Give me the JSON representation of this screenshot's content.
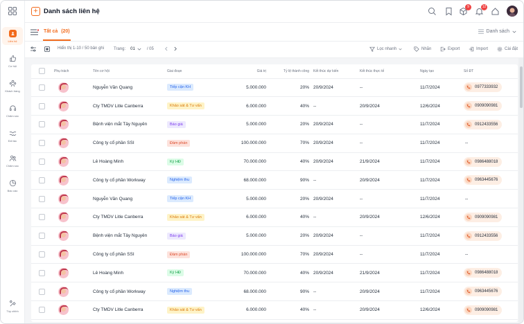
{
  "sidebar": {
    "items": [
      {
        "label": "Liên hệ",
        "icon": "contact-icon"
      },
      {
        "label": "Cơ hội",
        "icon": "thumbs-up-icon"
      },
      {
        "label": "Khách hàng",
        "icon": "customers-icon"
      },
      {
        "label": "Chăm sóc",
        "icon": "headset-icon"
      },
      {
        "label": "Đối tác",
        "icon": "handshake-icon"
      },
      {
        "label": "Chăm sóc",
        "icon": "group-icon"
      },
      {
        "label": "Báo cáo",
        "icon": "chart-icon"
      },
      {
        "label": "Tùy chỉnh",
        "icon": "settings-icon"
      }
    ]
  },
  "header": {
    "title": "Danh sách liên hệ",
    "badges": {
      "messages": "9",
      "notifications": "12"
    }
  },
  "tabs": {
    "all_label": "Tất cả",
    "all_count": "(20)",
    "view_label": "Danh sách"
  },
  "toolbar": {
    "showing": "Hiển thị 1-10 / 50 bản ghi",
    "page_label": "Trang:",
    "page_value": "01",
    "page_total": "/ 05",
    "filter": "Lọc nhanh",
    "tag": "Nhãn",
    "export": "Export",
    "import": "Import",
    "settings": "Cài đặt"
  },
  "table": {
    "headers": [
      "",
      "Phụ trách",
      "Tên cơ hội",
      "Giai đoạn",
      "Giá trị",
      "Tỷ lệ thành công",
      "Kết thúc dự kiến",
      "Kết thúc thực tế",
      "Ngày tạo",
      "Số ĐT"
    ],
    "rows": [
      {
        "name": "Nguyễn Văn Quang",
        "stage": "Tiếp cận KH",
        "stage_type": "blue",
        "value": "5.000.000",
        "rate": "20%",
        "expected": "20/9/2024",
        "actual": "--",
        "created": "11/7/2024",
        "phone": "0977333932"
      },
      {
        "name": "Cty TMDV Litle Canberra",
        "stage": "Khảo sát & Tư vấn",
        "stage_type": "yellow",
        "value": "6.000.000",
        "rate": "40%",
        "expected": "--",
        "actual": "20/9/2024",
        "created": "12/6/2024",
        "phone": "0909090981"
      },
      {
        "name": "Bệnh viện mắt Tây Nguyên",
        "stage": "Báo giá",
        "stage_type": "purple",
        "value": "5.000.000",
        "rate": "20%",
        "expected": "20/9/2024",
        "actual": "--",
        "created": "11/7/2024",
        "phone": "0912433556"
      },
      {
        "name": "Công ty cổ phần SSI",
        "stage": "Đàm phán",
        "stage_type": "red",
        "value": "100.000.000",
        "rate": "70%",
        "expected": "20/9/2024",
        "actual": "--",
        "created": "11/7/2024",
        "phone": ""
      },
      {
        "name": "Lê Hoàng Minh",
        "stage": "Ký HĐ",
        "stage_type": "green",
        "value": "70.000.000",
        "rate": "40%",
        "expected": "20/9/2024",
        "actual": "21/9/2024",
        "created": "11/7/2024",
        "phone": "0986488018"
      },
      {
        "name": "Công ty cổ phần Workway",
        "stage": "Nghiệm thu",
        "stage_type": "blue",
        "value": "68.000.000",
        "rate": "90%",
        "expected": "--",
        "actual": "20/9/2024",
        "created": "11/7/2024",
        "phone": "0963445676"
      },
      {
        "name": "Nguyễn Văn Quang",
        "stage": "Tiếp cận KH",
        "stage_type": "blue",
        "value": "5.000.000",
        "rate": "20%",
        "expected": "20/9/2024",
        "actual": "--",
        "created": "11/7/2024",
        "phone": ""
      },
      {
        "name": "Cty TMDV Litle Canberra",
        "stage": "Khảo sát & Tư vấn",
        "stage_type": "yellow",
        "value": "6.000.000",
        "rate": "40%",
        "expected": "--",
        "actual": "20/9/2024",
        "created": "12/6/2024",
        "phone": "0909090981"
      },
      {
        "name": "Bệnh viện mắt Tây Nguyên",
        "stage": "Báo giá",
        "stage_type": "purple",
        "value": "5.000.000",
        "rate": "20%",
        "expected": "20/9/2024",
        "actual": "--",
        "created": "11/7/2024",
        "phone": "0912433556"
      },
      {
        "name": "Công ty cổ phần SSI",
        "stage": "Đàm phán",
        "stage_type": "red",
        "value": "100.000.000",
        "rate": "70%",
        "expected": "20/9/2024",
        "actual": "--",
        "created": "11/7/2024",
        "phone": ""
      },
      {
        "name": "Lê Hoàng Minh",
        "stage": "Ký HĐ",
        "stage_type": "green",
        "value": "70.000.000",
        "rate": "40%",
        "expected": "20/9/2024",
        "actual": "21/9/2024",
        "created": "11/7/2024",
        "phone": "0986488018"
      },
      {
        "name": "Công ty cổ phần Workway",
        "stage": "Nghiệm thu",
        "stage_type": "blue",
        "value": "68.000.000",
        "rate": "90%",
        "expected": "--",
        "actual": "20/9/2024",
        "created": "11/7/2024",
        "phone": "0963445676"
      },
      {
        "name": "Cty TMDV Litle Canberra",
        "stage": "Khảo sát & Tư vấn",
        "stage_type": "yellow",
        "value": "6.000.000",
        "rate": "40%",
        "expected": "--",
        "actual": "20/9/2024",
        "created": "12/6/2024",
        "phone": "0909090981"
      }
    ],
    "empty_phone": "--"
  },
  "colors": {
    "accent": "#f26a1b",
    "stage_blue_bg": "#dbeafe",
    "stage_blue_fg": "#2563eb",
    "stage_yellow_bg": "#fef3c7",
    "stage_yellow_fg": "#d97706",
    "stage_purple_bg": "#ede9fe",
    "stage_purple_fg": "#7c3aed",
    "stage_red_bg": "#fde2dc",
    "stage_red_fg": "#dc4a2a",
    "stage_green_bg": "#dcfce7",
    "stage_green_fg": "#16a34a"
  }
}
